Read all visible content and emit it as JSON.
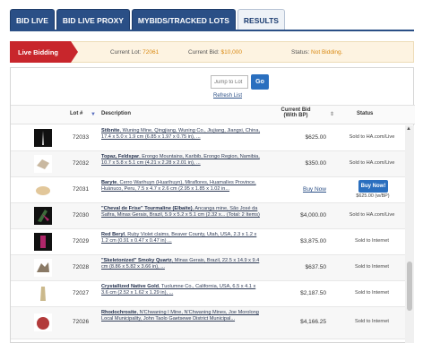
{
  "tabs": [
    {
      "label": "BID LIVE",
      "active": false
    },
    {
      "label": "BID LIVE PROXY",
      "active": false
    },
    {
      "label": "MYBIDS/TRACKED LOTS",
      "active": false
    },
    {
      "label": "RESULTS",
      "active": true
    }
  ],
  "live_bar": {
    "badge": "Live Bidding",
    "current_lot_label": "Current Lot:",
    "current_lot_value": "72061",
    "current_bid_label": "Current Bid:",
    "current_bid_value": "$10,000",
    "status_label": "Status:",
    "status_value": "Not Bidding."
  },
  "jump": {
    "placeholder": "Jump to Lot",
    "go_label": "Go",
    "refresh_label": "Refresh List"
  },
  "table": {
    "headers": {
      "lot": "Lot #",
      "description": "Description",
      "current_bid_1": "Current Bid",
      "current_bid_2": "(With BP)",
      "status": "Status"
    },
    "rows": [
      {
        "lot": "72033",
        "title": "Stibnite",
        "rest": ", Wuning Mine, Qingjiang, Wuning Co., Jiujiang, Jiangxi, China, 17.4 x 5.0 x 1.9 cm (6.85 x 1.97 x 0.75 in), ...",
        "bid": "$625.00",
        "status": "Sold to HA.com/Live",
        "thumb": "#d6d6d6"
      },
      {
        "lot": "72032",
        "title": "Topaz, Feldspar",
        "rest": ", Erongo Mountains, Karibib, Erongo Region, Namibia, 10.7 x 5.8 x 5.1 cm (4.21 x 2.28 x 2.01 in), ...",
        "bid": "$350.00",
        "status": "Sold to HA.com/Live",
        "thumb": "#c9b8a0"
      },
      {
        "lot": "72031",
        "title": "Baryte",
        "rest": ", Cerro Warihuyn (Huarihuyn), Miraflores, Huamalíes Province, Huánuco, Peru, 7.5 x 4.7 x 2.6 cm (2.95 x 1.85 x 1.02 in...",
        "bid": "Buy Now",
        "status": "",
        "buy_now": "Buy Now!",
        "buy_now_sub": "$625.00 (w/BP)",
        "thumb": "#e2c79a"
      },
      {
        "lot": "72030",
        "title": "\"Cheval de Frise\" Tourmaline (Elbaite)",
        "rest": ", Ancanga mine, São José da Safira, Minas Gerais, Brazil, 5.9 x 5.2 x 5.1 cm (2.32 x... (Total: 2 Items)",
        "bid": "$4,000.00",
        "status": "Sold to HA.com/Live",
        "thumb": "#3c6b3a"
      },
      {
        "lot": "72029",
        "title": "Red Beryl",
        "rest": ", Ruby Violet claims, Beaver County, Utah, USA, 2.3 x 1.2 x 1.2 cm (0.91 x 0.47 x 0.47 in) ...",
        "bid": "$3,875.00",
        "status": "Sold to Internet",
        "thumb": "#b0266a"
      },
      {
        "lot": "72028",
        "title": "\"Skeletonized\" Smoky Quartz",
        "rest": ", Minas Gerais, Brazil, 22.5 x 14.9 x 9.4 cm (8.86 x 5.82 x 3.66 in), ...",
        "bid": "$637.50",
        "status": "Sold to Internet",
        "thumb": "#8a7a66"
      },
      {
        "lot": "72027",
        "title": "Crystallized Native Gold",
        "rest": ", Tuolumne Co., California, USA, 6.5 x 4.1 x 3.6 cm (2.52 x 1.62 x 1.29 in), ...",
        "bid": "$2,187.50",
        "status": "Sold to Internet",
        "thumb": "#cbb98c"
      },
      {
        "lot": "72026",
        "title": "Rhodochrosite",
        "rest": ", N'Chwaning I Mine, N'Chwaning Mines, Joe Morolong Local Municipality, John Taolo Gaetsewe District Municipal...",
        "bid": "$4,166.25",
        "status": "Sold to Internet",
        "thumb": "#b23a3a"
      }
    ]
  },
  "colors": {
    "accent": "#2a4f86",
    "live_red": "#c8262c",
    "highlight": "#d98a14",
    "button_blue": "#2a6fbf"
  }
}
